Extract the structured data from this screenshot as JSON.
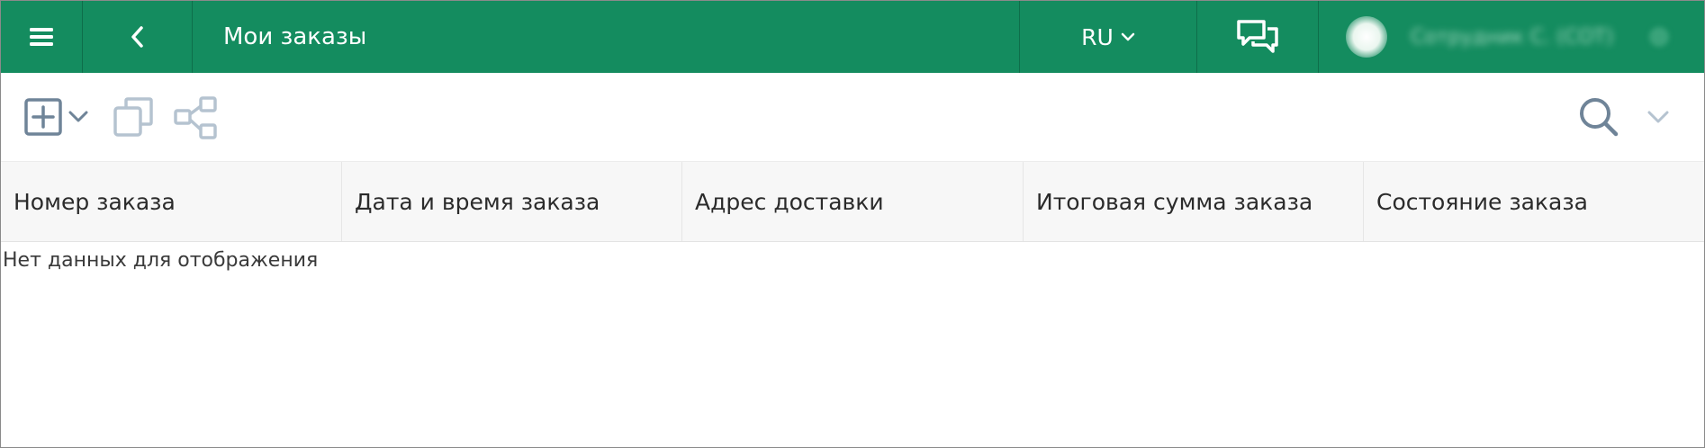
{
  "header": {
    "title": "Мои заказы",
    "language": "RU",
    "user_name": "Сотрудник С. (СОТ)",
    "brand_color": "#148c5f",
    "icons": [
      "menu-icon",
      "back-arrow-icon",
      "chevron-down-icon",
      "chat-icon"
    ]
  },
  "toolbar": {
    "icons": [
      "add-icon",
      "chevron-down-icon",
      "copy-icon",
      "share-icon",
      "search-icon",
      "chevron-down-icon"
    ],
    "icon_color": "#6f8498",
    "disabled_icon_color": "#b5c3d0"
  },
  "table": {
    "columns": [
      "Номер заказа",
      "Дата и время заказа",
      "Адрес доставки",
      "Итоговая сумма заказа",
      "Состояние заказа"
    ],
    "empty_text": "Нет данных для отображения"
  }
}
